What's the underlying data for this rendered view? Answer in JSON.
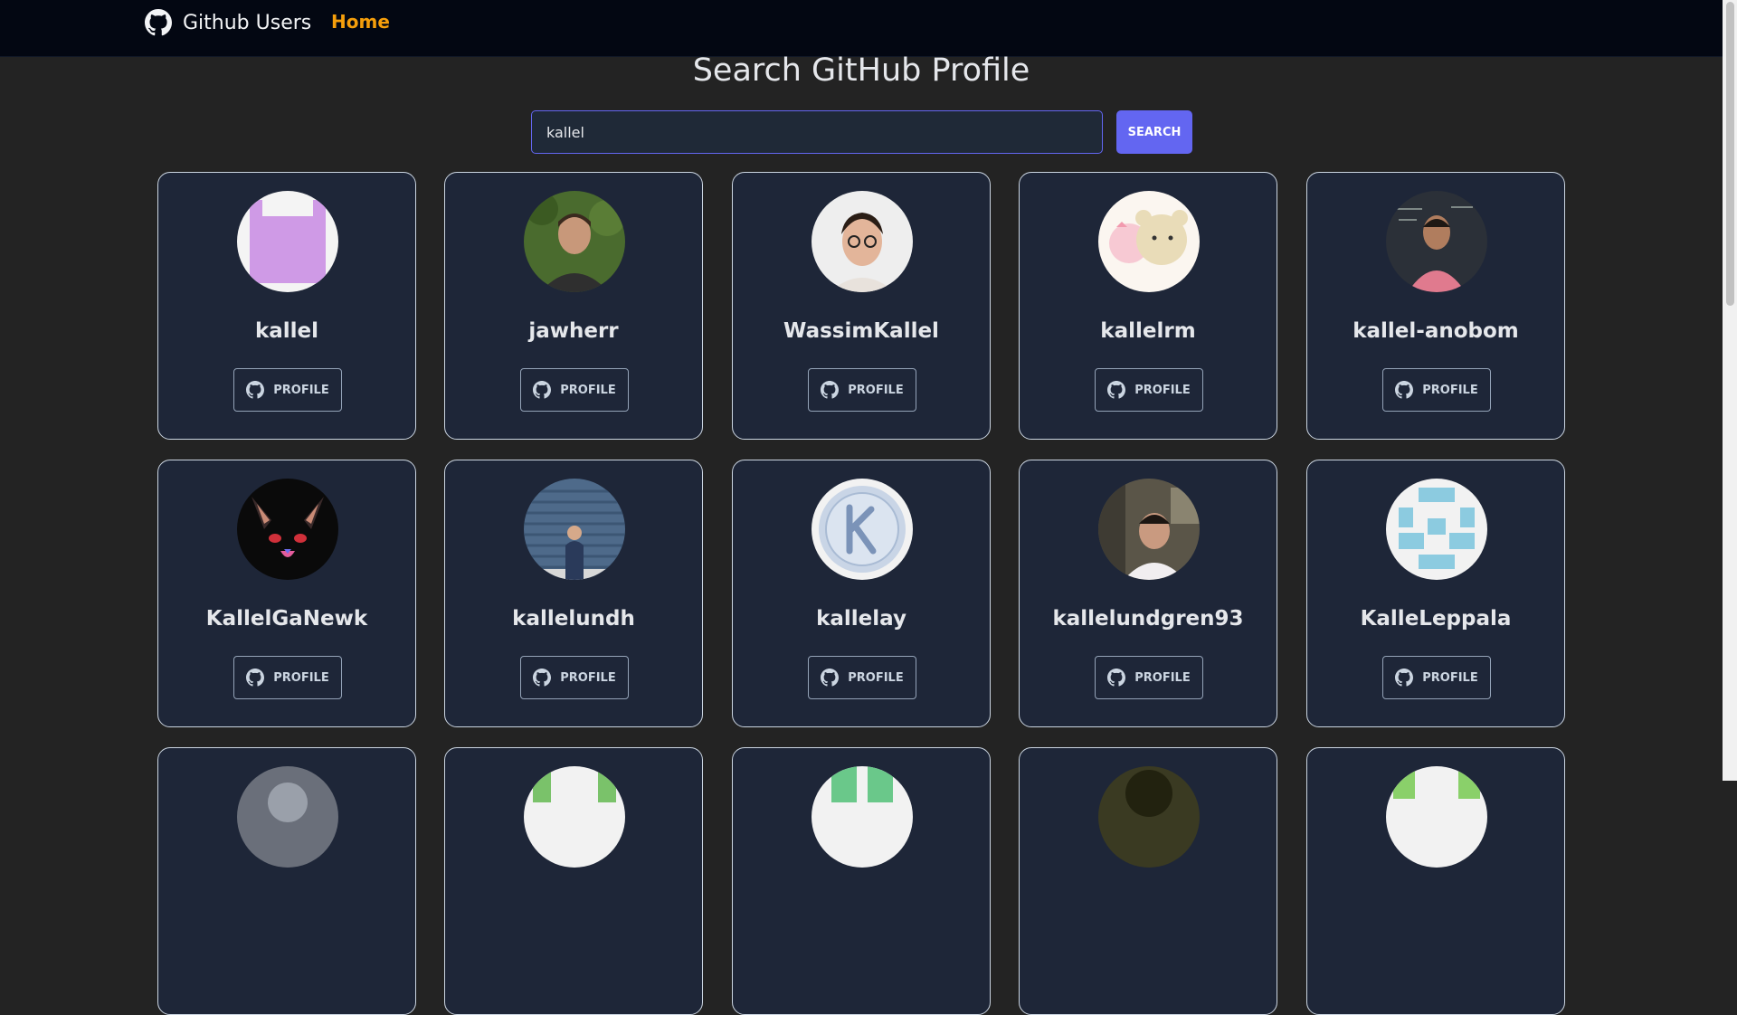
{
  "nav": {
    "brand": "Github Users",
    "home": "Home"
  },
  "page": {
    "title": "Search GitHub Profile"
  },
  "search": {
    "value": "kallel",
    "button": "SEARCH"
  },
  "profile_label": "PROFILE",
  "users": [
    {
      "login": "kallel"
    },
    {
      "login": "jawherr"
    },
    {
      "login": "WassimKallel"
    },
    {
      "login": "kallelrm"
    },
    {
      "login": "kallel-anobom"
    },
    {
      "login": "KallelGaNewk"
    },
    {
      "login": "kallelundh"
    },
    {
      "login": "kallelay"
    },
    {
      "login": "kallelundgren93"
    },
    {
      "login": "KalleLeppala"
    },
    {
      "login": ""
    },
    {
      "login": ""
    },
    {
      "login": ""
    },
    {
      "login": ""
    },
    {
      "login": ""
    }
  ],
  "colors": {
    "accent": "#6366f1",
    "home_link": "#f59e0b",
    "card_bg": "#1e2638",
    "nav_bg": "#030712"
  }
}
